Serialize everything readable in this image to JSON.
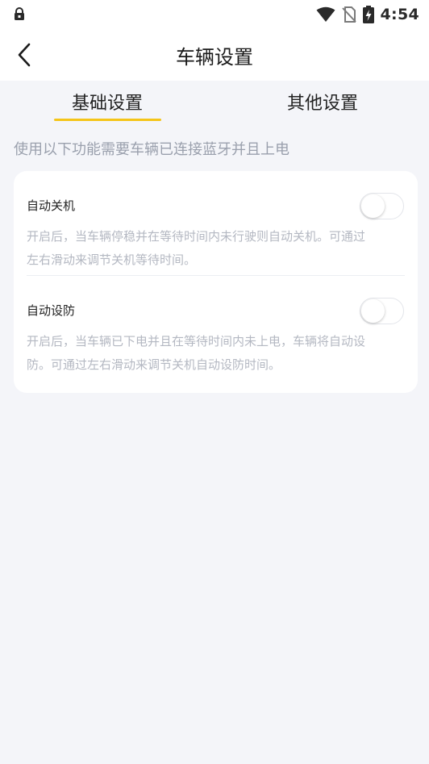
{
  "status_bar": {
    "time": "4:54"
  },
  "nav": {
    "title": "车辆设置"
  },
  "tabs": [
    {
      "label": "基础设置",
      "active": true
    },
    {
      "label": "其他设置",
      "active": false
    }
  ],
  "notice": "使用以下功能需要车辆已连接蓝牙并且上电",
  "settings": [
    {
      "title": "自动关机",
      "desc_line1": "开启后，当车辆停稳并在等待时间内未行驶则自动关机。可通过",
      "desc_line2": "左右滑动来调节关机等待时间。",
      "enabled": false
    },
    {
      "title": "自动设防",
      "desc_line1": "开启后，当车辆已下电并且在等待时间内未上电，车辆将自动设",
      "desc_line2": "防。可通过左右滑动来调节关机自动设防时间。",
      "enabled": false
    }
  ],
  "colors": {
    "accent": "#f5c518",
    "background": "#f4f5f9",
    "muted_text": "#9aa0ad"
  }
}
